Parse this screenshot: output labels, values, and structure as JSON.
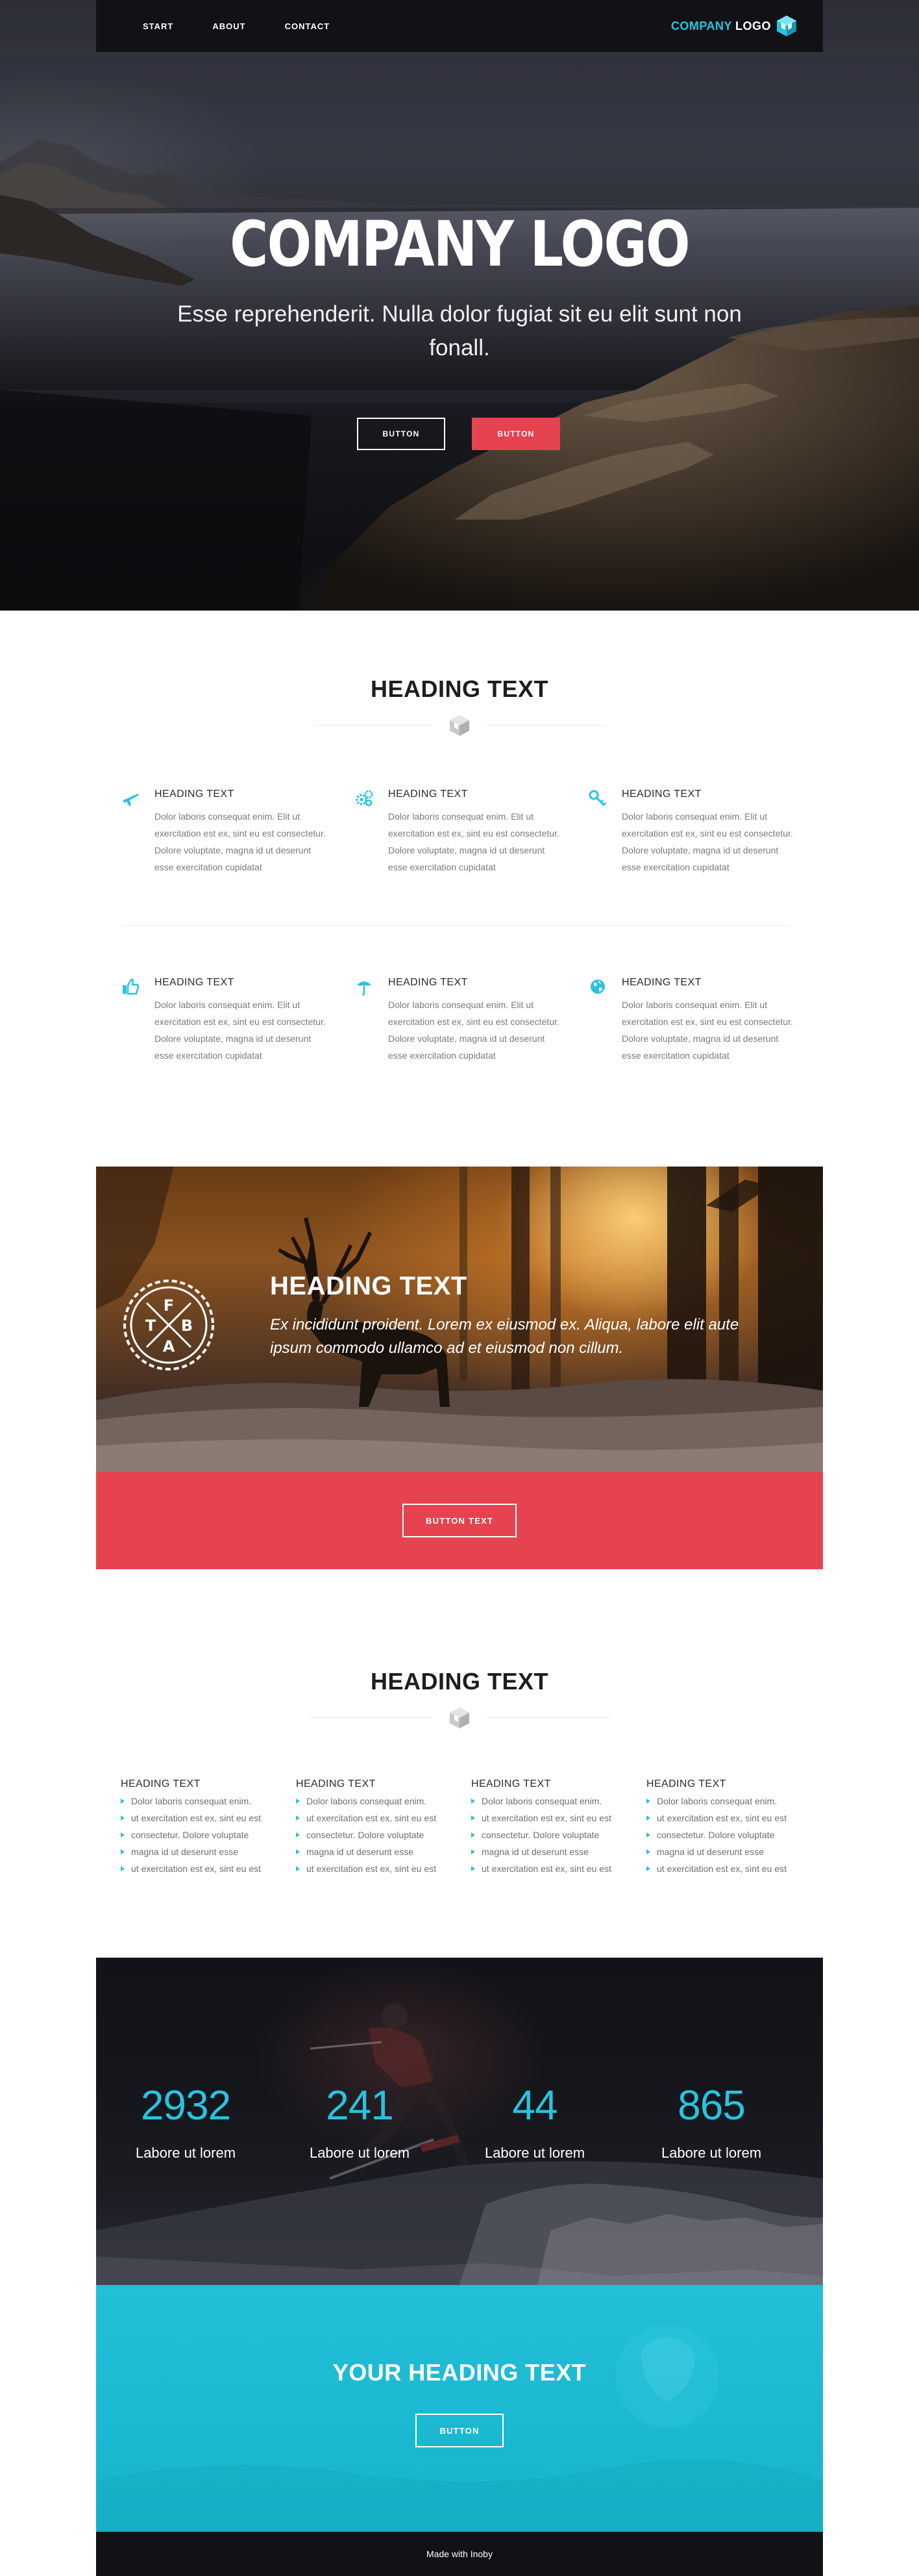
{
  "nav": {
    "links": [
      "START",
      "ABOUT",
      "CONTACT"
    ],
    "brand_part1": "COMPANY",
    "brand_part2": "LOGO"
  },
  "hero": {
    "title": "COMPANY LOGO",
    "subtitle": "Esse reprehenderit. Nulla dolor fugiat sit eu elit sunt non fonall.",
    "button1": "BUTTON",
    "button2": "BUTTON"
  },
  "features_section": {
    "heading": "HEADING TEXT",
    "items": [
      {
        "icon": "plane-icon",
        "title": "HEADING TEXT",
        "text": "Dolor laboris consequat enim. Elit ut exercitation est ex, sint eu est consectetur. Dolore voluptate, magna id ut deserunt esse exercitation cupidatat"
      },
      {
        "icon": "gears-icon",
        "title": "HEADING TEXT",
        "text": "Dolor laboris consequat enim. Elit ut exercitation est ex, sint eu est consectetur. Dolore voluptate, magna id ut deserunt esse exercitation cupidatat"
      },
      {
        "icon": "key-icon",
        "title": "HEADING TEXT",
        "text": "Dolor laboris consequat enim. Elit ut exercitation est ex, sint eu est consectetur. Dolore voluptate, magna id ut deserunt esse exercitation cupidatat"
      },
      {
        "icon": "thumbs-up-icon",
        "title": "HEADING TEXT",
        "text": "Dolor laboris consequat enim. Elit ut exercitation est ex, sint eu est consectetur. Dolore voluptate, magna id ut deserunt esse exercitation cupidatat"
      },
      {
        "icon": "umbrella-icon",
        "title": "HEADING TEXT",
        "text": "Dolor laboris consequat enim. Elit ut exercitation est ex, sint eu est consectetur. Dolore voluptate, magna id ut deserunt esse exercitation cupidatat"
      },
      {
        "icon": "globe-icon",
        "title": "HEADING TEXT",
        "text": "Dolor laboris consequat enim. Elit ut exercitation est ex, sint eu est consectetur. Dolore voluptate, magna id ut deserunt esse exercitation cupidatat"
      }
    ]
  },
  "banner": {
    "badge_letters": [
      "F",
      "T",
      "B",
      "A"
    ],
    "heading": "HEADING TEXT",
    "text": "Ex incididunt proident. Lorem ex eiusmod ex. Aliqua, labore elit aute ipsum commodo ullamco ad et eiusmod non cillum.",
    "button": "BUTTON TEXT"
  },
  "list_section": {
    "heading": "HEADING TEXT",
    "columns": [
      {
        "title": "HEADING TEXT",
        "items": [
          "Dolor laboris consequat enim.",
          "ut exercitation est ex, sint eu est",
          "consectetur. Dolore voluptate",
          "magna id ut deserunt esse",
          "ut exercitation est ex, sint eu est"
        ]
      },
      {
        "title": "HEADING TEXT",
        "items": [
          "Dolor laboris consequat enim.",
          "ut exercitation est ex, sint eu est",
          "consectetur. Dolore voluptate",
          "magna id ut deserunt esse",
          "ut exercitation est ex, sint eu est"
        ]
      },
      {
        "title": "HEADING TEXT",
        "items": [
          "Dolor laboris consequat enim.",
          "ut exercitation est ex, sint eu est",
          "consectetur. Dolore voluptate",
          "magna id ut deserunt esse",
          "ut exercitation est ex, sint eu est"
        ]
      },
      {
        "title": "HEADING TEXT",
        "items": [
          "Dolor laboris consequat enim.",
          "ut exercitation est ex, sint eu est",
          "consectetur. Dolore voluptate",
          "magna id ut deserunt esse",
          "ut exercitation est ex, sint eu est"
        ]
      }
    ]
  },
  "stats": [
    {
      "value": "2932",
      "label": "Labore ut lorem"
    },
    {
      "value": "241",
      "label": "Labore ut lorem"
    },
    {
      "value": "44",
      "label": "Labore ut lorem"
    },
    {
      "value": "865",
      "label": "Labore ut lorem"
    }
  ],
  "cta": {
    "heading": "YOUR HEADING TEXT",
    "button": "BUTTON"
  },
  "footer": {
    "text": "Made with Inoby"
  },
  "colors": {
    "accent_cyan": "#29c3df",
    "accent_red": "#e5434f",
    "dark": "#121216"
  }
}
